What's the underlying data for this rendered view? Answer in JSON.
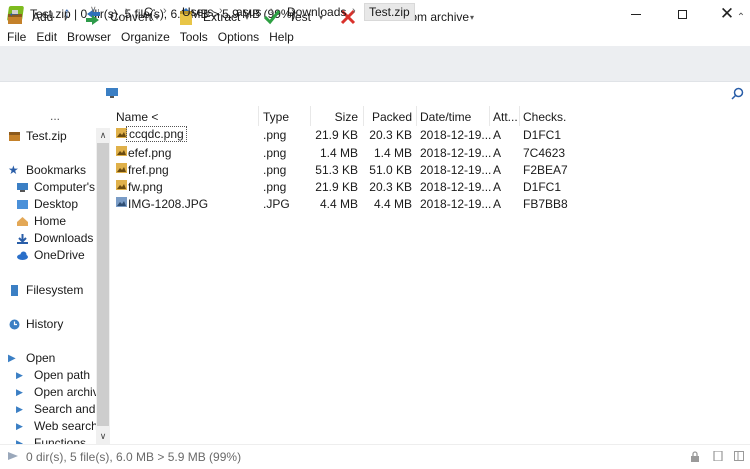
{
  "window": {
    "title": "Test.zip | 0 dir(s), 5 file(s), 6.0 MB > 5.9 MB (99%)",
    "app_icon": "peazip-icon",
    "controls": [
      "minimize-icon",
      "maximize-icon",
      "close-icon"
    ]
  },
  "menu": [
    "File",
    "Edit",
    "Browser",
    "Organize",
    "Tools",
    "Options",
    "Help"
  ],
  "toolbar": {
    "add": "Add",
    "convert": "Convert",
    "extract": "Extract",
    "test": "Test",
    "delete": "Delete from archive",
    "colors": {
      "add_icon": "#c4812a",
      "convert_icon": "#2e9a4a",
      "extract_icon": "#e8c547",
      "test_icon": "#2ea043",
      "delete_icon": "#d9312b"
    }
  },
  "address": {
    "crumbs": [
      "C:",
      "Users",
      "asus",
      "Downloads",
      "Test.zip"
    ],
    "search_icon": "search-icon"
  },
  "sidebar": {
    "more": "...",
    "archive": "Test.zip",
    "bookmarks_header": "Bookmarks",
    "bookmarks": [
      "Computer's r",
      "Desktop",
      "Home",
      "Downloads",
      "OneDrive"
    ],
    "filesystem": "Filesystem",
    "history": "History",
    "open_header": "Open",
    "open_items": [
      "Open path",
      "Open archive",
      "Search and d",
      "Web search",
      "Functions"
    ]
  },
  "columns": [
    "Name <",
    "Type",
    "Size",
    "Packed",
    "Date/time",
    "Att...",
    "Checks..."
  ],
  "files": [
    {
      "name": "ccqdc.png",
      "type": ".png",
      "size": "21.9 KB",
      "packed": "20.3 KB",
      "date": "2018-12-19...",
      "attr": "A",
      "checksum": "D1FC1"
    },
    {
      "name": "efef.png",
      "type": ".png",
      "size": "1.4 MB",
      "packed": "1.4 MB",
      "date": "2018-12-19...",
      "attr": "A",
      "checksum": "7C4623"
    },
    {
      "name": "fref.png",
      "type": ".png",
      "size": "51.3 KB",
      "packed": "51.0 KB",
      "date": "2018-12-19...",
      "attr": "A",
      "checksum": "F2BEA7"
    },
    {
      "name": "fw.png",
      "type": ".png",
      "size": "21.9 KB",
      "packed": "20.3 KB",
      "date": "2018-12-19...",
      "attr": "A",
      "checksum": "D1FC1"
    },
    {
      "name": "IMG-1208.JPG",
      "type": ".JPG",
      "size": "4.4 MB",
      "packed": "4.4 MB",
      "date": "2018-12-19...",
      "attr": "A",
      "checksum": "FB7BB8"
    }
  ],
  "status": {
    "text": "0 dir(s), 5 file(s), 6.0 MB > 5.9 MB (99%)"
  }
}
